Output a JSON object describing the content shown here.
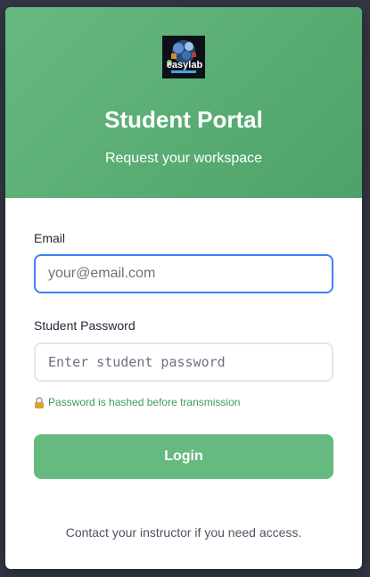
{
  "header": {
    "logo_text": "easylab",
    "title": "Student Portal",
    "subtitle": "Request your workspace"
  },
  "form": {
    "email_label": "Email",
    "email_placeholder": "your@email.com",
    "password_label": "Student Password",
    "password_placeholder": "Enter student password",
    "hint": "Password is hashed before transmission",
    "login_label": "Login"
  },
  "footer": {
    "text": "Contact your instructor if you need access."
  },
  "colors": {
    "header_start": "#67b97f",
    "header_end": "#4ea269",
    "button": "#66ba7f",
    "focus_border": "#3b82f6",
    "hint_text": "#3d9a60"
  },
  "icons": {
    "logo": "easylab-logo",
    "lock": "lock-icon"
  }
}
